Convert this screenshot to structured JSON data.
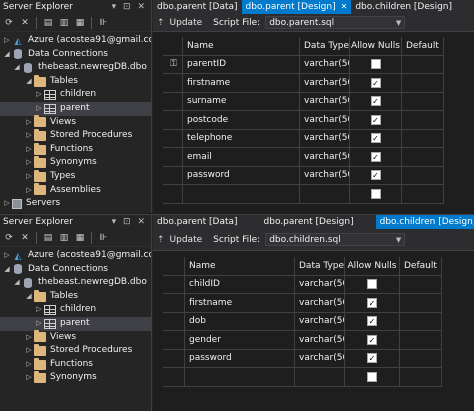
{
  "top": {
    "server_explorer": {
      "title": "Server Explorer",
      "controls": "▾ ⊡ ✕",
      "nodes": [
        {
          "label": "Azure (acostea91@gmail.co"
        },
        {
          "label": "Data Connections"
        },
        {
          "label": "thebeast.newregDB.dbo"
        },
        {
          "label": "Tables"
        },
        {
          "label": "children"
        },
        {
          "label": "parent"
        },
        {
          "label": "Views"
        },
        {
          "label": "Stored Procedures"
        },
        {
          "label": "Functions"
        },
        {
          "label": "Synonyms"
        },
        {
          "label": "Types"
        },
        {
          "label": "Assemblies"
        },
        {
          "label": "Servers"
        }
      ]
    },
    "tabs": [
      {
        "label": "dbo.parent [Data]"
      },
      {
        "label": "dbo.parent [Design]",
        "close": "✕"
      },
      {
        "label": "dbo.children [Design]"
      }
    ],
    "toolbar": {
      "update": "Update",
      "script_file_label": "Script File:",
      "script_file": "dbo.parent.sql"
    },
    "grid": {
      "headers": [
        "Name",
        "Data Type",
        "Allow Nulls",
        "Default"
      ],
      "rows": [
        {
          "name": "parentID",
          "type": "varchar(50)",
          "nulls": false,
          "key": true
        },
        {
          "name": "firstname",
          "type": "varchar(50)",
          "nulls": true
        },
        {
          "name": "surname",
          "type": "varchar(50)",
          "nulls": true
        },
        {
          "name": "postcode",
          "type": "varchar(50)",
          "nulls": true
        },
        {
          "name": "telephone",
          "type": "varchar(50)",
          "nulls": true
        },
        {
          "name": "email",
          "type": "varchar(50)",
          "nulls": true
        },
        {
          "name": "password",
          "type": "varchar(50)",
          "nulls": true
        },
        {
          "name": "",
          "type": "",
          "nulls": false
        }
      ]
    }
  },
  "bottom": {
    "server_explorer": {
      "title": "Server Explorer",
      "controls": "▾ ⊡ ✕",
      "nodes": [
        {
          "label": "Azure (acostea91@gmail.com"
        },
        {
          "label": "Data Connections"
        },
        {
          "label": "thebeast.newregDB.dbo"
        },
        {
          "label": "Tables"
        },
        {
          "label": "children"
        },
        {
          "label": "parent"
        },
        {
          "label": "Views"
        },
        {
          "label": "Stored Procedures"
        },
        {
          "label": "Functions"
        },
        {
          "label": "Synonyms"
        }
      ]
    },
    "tabs": [
      {
        "label": "dbo.parent [Data]"
      },
      {
        "label": "dbo.parent [Design]"
      },
      {
        "label": "dbo.children [Design]",
        "close": "✕"
      }
    ],
    "toolbar": {
      "update": "Update",
      "script_file_label": "Script File:",
      "script_file": "dbo.children.sql"
    },
    "grid": {
      "headers": [
        "Name",
        "Data Type",
        "Allow Nulls",
        "Default"
      ],
      "rows": [
        {
          "name": "childID",
          "type": "varchar(50)",
          "nulls": false
        },
        {
          "name": "firstname",
          "type": "varchar(50)",
          "nulls": true
        },
        {
          "name": "dob",
          "type": "varchar(50)",
          "nulls": true
        },
        {
          "name": "gender",
          "type": "varchar(50)",
          "nulls": true
        },
        {
          "name": "password",
          "type": "varchar(50)",
          "nulls": true
        },
        {
          "name": "",
          "type": "",
          "nulls": false
        }
      ]
    }
  },
  "colors": {
    "accent": "#007acc",
    "panel": "#252526",
    "editor": "#1e1e1e",
    "folder": "#dcb67a"
  }
}
